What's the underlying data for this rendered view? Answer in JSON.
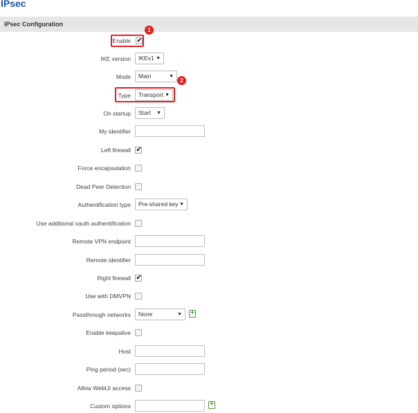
{
  "page": {
    "title": "IPsec"
  },
  "section": {
    "title": "IPsec Configuration"
  },
  "fields": {
    "enable": {
      "label": "Enable",
      "checked": true
    },
    "ike_version": {
      "label": "IKE version",
      "value": "IKEv1"
    },
    "mode": {
      "label": "Mode",
      "value": "Main"
    },
    "type": {
      "label": "Type",
      "value": "Transport"
    },
    "on_startup": {
      "label": "On startup",
      "value": "Start"
    },
    "my_identifier": {
      "label": "My identifier",
      "value": ""
    },
    "left_firewall": {
      "label": "Left firewall",
      "checked": true
    },
    "force_encapsulation": {
      "label": "Force encapsulation",
      "checked": false
    },
    "dead_peer_detection": {
      "label": "Dead Peer Detection",
      "checked": false
    },
    "auth_type": {
      "label": "Authentification type",
      "value": "Pre-shared key"
    },
    "xauth": {
      "label": "Use additional xauth authentification",
      "checked": false
    },
    "remote_endpoint": {
      "label": "Remote VPN endpoint",
      "value": ""
    },
    "remote_identifier": {
      "label": "Remote identifier",
      "value": ""
    },
    "right_firewall": {
      "label": "Right firewall",
      "checked": true
    },
    "dmvpn": {
      "label": "Use with DMVPN",
      "checked": false
    },
    "passthrough": {
      "label": "Passthrough networks",
      "value": "None"
    },
    "keepalive": {
      "label": "Enable keepalive",
      "checked": false
    },
    "host": {
      "label": "Host",
      "value": ""
    },
    "ping_period": {
      "label": "Ping period (sec)",
      "value": ""
    },
    "webui_access": {
      "label": "Allow WebUI access",
      "checked": false
    },
    "custom_options": {
      "label": "Custom options",
      "value": ""
    }
  },
  "glyphs": {
    "check": "✔",
    "arrow": "▼",
    "plus": "+"
  },
  "annotations": {
    "badge1": "1",
    "badge2": "2"
  },
  "colors": {
    "title": "#1a55a3",
    "highlight": "#e02020",
    "header_bg": "#e6e6e6",
    "add_icon": "#2f9a2f"
  }
}
